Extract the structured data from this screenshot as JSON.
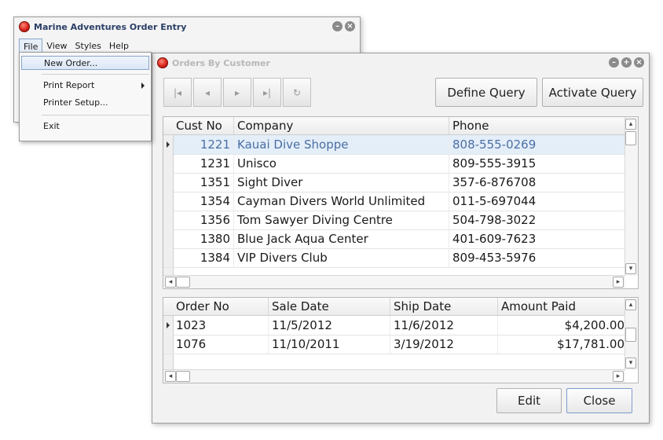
{
  "main_window": {
    "title": "Marine Adventures Order Entry",
    "menu": [
      "File",
      "View",
      "Styles",
      "Help"
    ]
  },
  "file_menu": {
    "items": [
      "New Order...",
      "Print Report",
      "Printer Setup...",
      "Exit"
    ]
  },
  "orders_window": {
    "title": "Orders By Customer",
    "toolbar": {
      "define_query": "Define Query",
      "activate_query": "Activate Query",
      "nav_icons": [
        "first-record-icon",
        "prior-record-icon",
        "next-record-icon",
        "last-record-icon",
        "refresh-icon"
      ]
    },
    "customers": {
      "headers": [
        "Cust No",
        "Company",
        "Phone"
      ],
      "rows": [
        [
          "1221",
          "Kauai Dive Shoppe",
          "808-555-0269"
        ],
        [
          "1231",
          "Unisco",
          "809-555-3915"
        ],
        [
          "1351",
          "Sight Diver",
          "357-6-876708"
        ],
        [
          "1354",
          "Cayman Divers World Unlimited",
          "011-5-697044"
        ],
        [
          "1356",
          "Tom Sawyer Diving Centre",
          "504-798-3022"
        ],
        [
          "1380",
          "Blue Jack Aqua Center",
          "401-609-7623"
        ],
        [
          "1384",
          "VIP Divers Club",
          "809-453-5976"
        ]
      ]
    },
    "orders": {
      "headers": [
        "Order No",
        "Sale Date",
        "Ship Date",
        "Amount Paid"
      ],
      "rows": [
        [
          "1023",
          "11/5/2012",
          "11/6/2012",
          "$4,200.00"
        ],
        [
          "1076",
          "11/10/2011",
          "3/19/2012",
          "$17,781.00"
        ]
      ]
    },
    "buttons": {
      "edit": "Edit",
      "close": "Close"
    }
  },
  "colors": {
    "accent": "#7d9ccc",
    "selected_row": "#e4eef8",
    "selected_text": "#4a6fa5"
  }
}
